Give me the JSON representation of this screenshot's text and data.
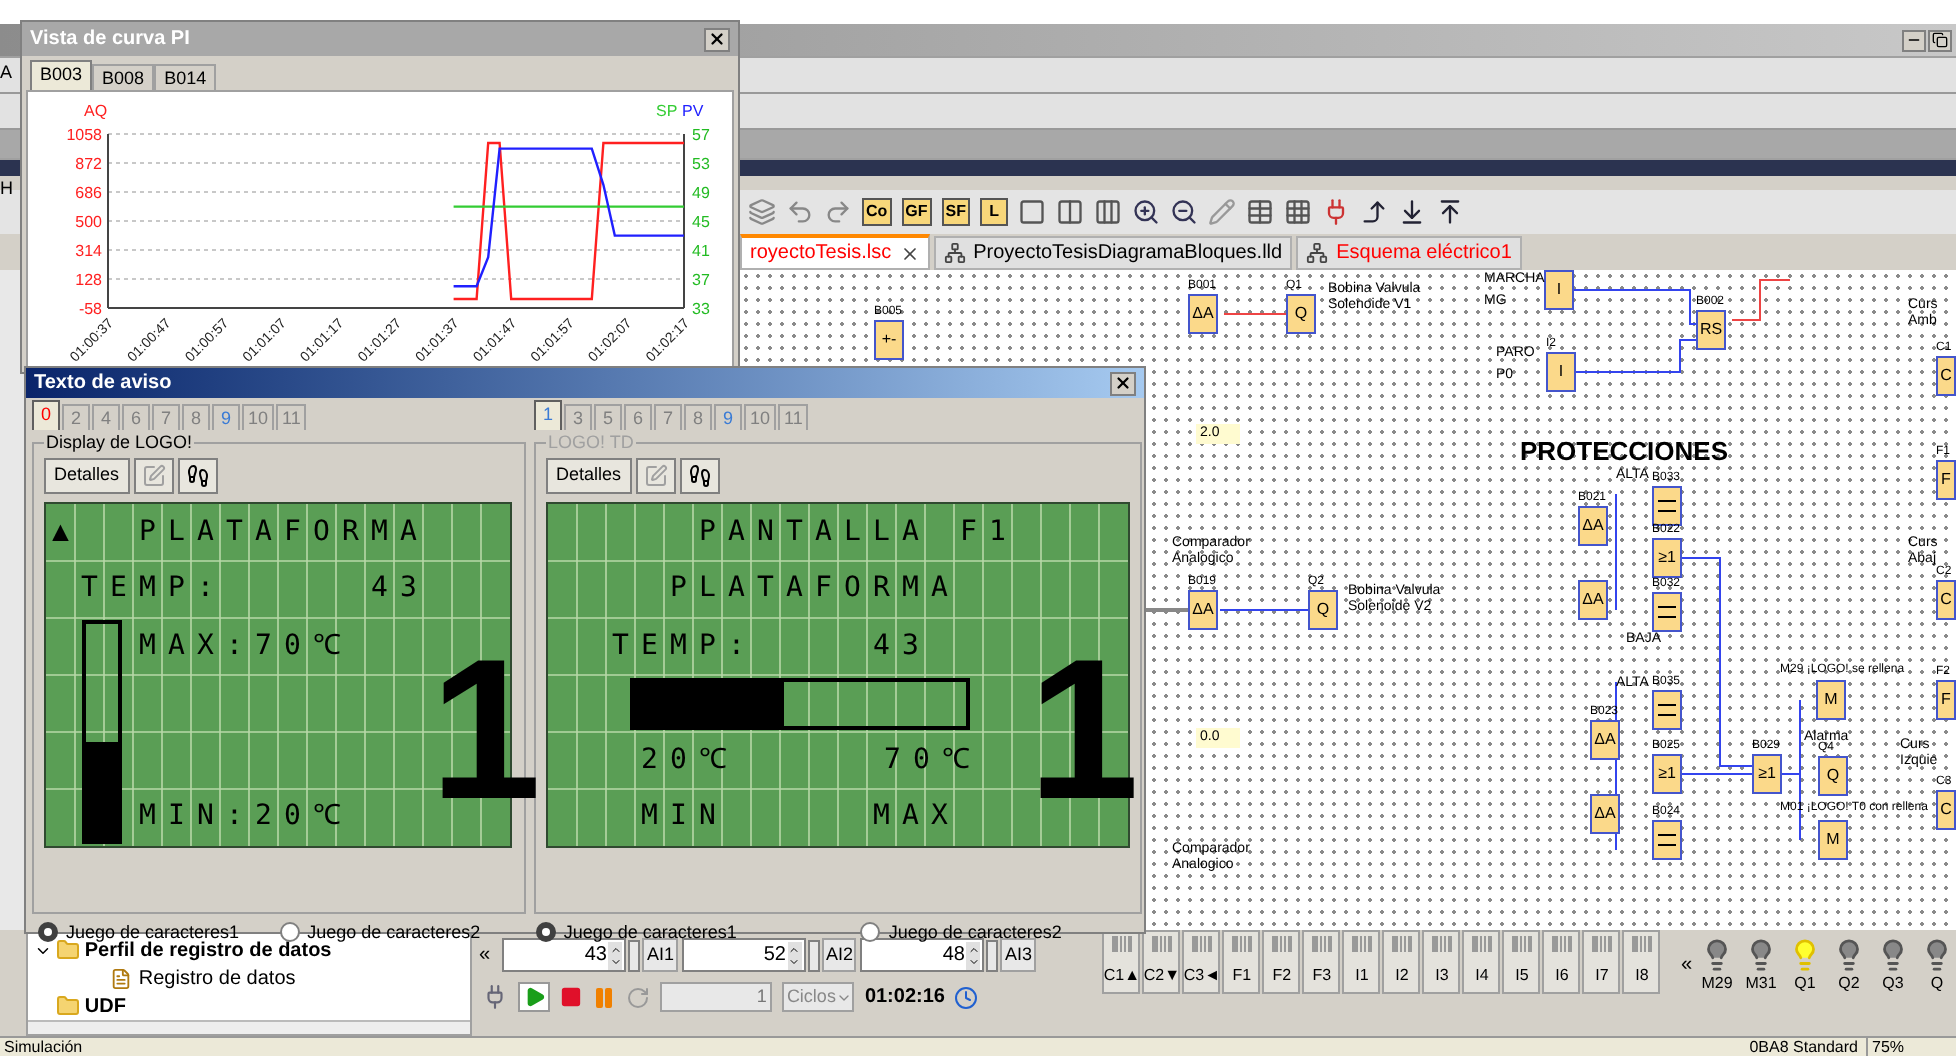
{
  "left_strip": {
    "labels": [
      "A",
      "H"
    ]
  },
  "chart_window": {
    "title": "Vista de curva PI",
    "tabs": [
      {
        "label": "B003",
        "selected": true
      },
      {
        "label": "B008",
        "selected": false
      },
      {
        "label": "B014",
        "selected": false
      }
    ],
    "chart_data": {
      "type": "line",
      "grid": true,
      "categories": [
        "01:00:37",
        null,
        null,
        null,
        null,
        "01:00:47",
        null,
        null,
        null,
        null,
        "01:00:57",
        null,
        null,
        null,
        null,
        "01:01:07",
        null,
        null,
        null,
        null,
        "01:01:17",
        null,
        null,
        null,
        null,
        "01:01:27",
        null,
        null,
        null,
        null,
        "01:01:37",
        null,
        null,
        null,
        null,
        "01:01:47",
        null,
        null,
        null,
        null,
        "01:01:57",
        null,
        null,
        null,
        null,
        "01:02:07",
        null,
        null,
        null,
        null,
        "01:02:17"
      ],
      "ylim": [
        -58,
        1058
      ],
      "yticks": [
        -58,
        128,
        314,
        500,
        686,
        872,
        1058
      ],
      "y2lim": [
        33,
        57
      ],
      "y2ticks": [
        33,
        37,
        41,
        45,
        49,
        53,
        57
      ],
      "series": [
        {
          "name": "AQ",
          "color": "#ff2020",
          "values": [
            null,
            null,
            null,
            null,
            null,
            null,
            null,
            null,
            null,
            null,
            null,
            null,
            null,
            null,
            null,
            null,
            null,
            null,
            null,
            null,
            null,
            null,
            null,
            null,
            null,
            null,
            null,
            null,
            null,
            null,
            0,
            0,
            0,
            1000,
            1000,
            0,
            0,
            0,
            0,
            0,
            0,
            0,
            0,
            1000,
            1000,
            1000,
            1000,
            1000,
            1000,
            1000,
            1000
          ]
        },
        {
          "name": "SP",
          "color": "#33cc33",
          "axis": "y2",
          "values": [
            null,
            null,
            null,
            null,
            null,
            null,
            null,
            null,
            null,
            null,
            null,
            null,
            null,
            null,
            null,
            null,
            null,
            null,
            null,
            null,
            null,
            null,
            null,
            null,
            null,
            null,
            null,
            null,
            null,
            null,
            47,
            47,
            47,
            47,
            47,
            47,
            47,
            47,
            47,
            47,
            47,
            47,
            47,
            47,
            47,
            47,
            47,
            47,
            47,
            47,
            47
          ]
        },
        {
          "name": "PV",
          "color": "#2020ff",
          "axis": "y2",
          "values": [
            null,
            null,
            null,
            null,
            null,
            null,
            null,
            null,
            null,
            null,
            null,
            null,
            null,
            null,
            null,
            null,
            null,
            null,
            null,
            null,
            null,
            null,
            null,
            null,
            null,
            null,
            null,
            null,
            null,
            null,
            36,
            36,
            36,
            40,
            55,
            55,
            55,
            55,
            55,
            55,
            55,
            55,
            55,
            50,
            43,
            43,
            43,
            43,
            43,
            43,
            43
          ]
        }
      ]
    }
  },
  "app": {
    "toolbar": {
      "buttons": [
        "Co",
        "GF",
        "SF",
        "L"
      ]
    },
    "tabs": [
      {
        "label": "royectoTesis.lsc",
        "selected": true,
        "color": "#ff0000"
      },
      {
        "label": "ProyectoTesisDiagramaBloques.lld",
        "selected": false,
        "color": "#000000"
      },
      {
        "label": "Esquema eléctrico1",
        "selected": false,
        "color": "#ff0000"
      }
    ],
    "diagram": {
      "labels": [
        "MARCHA",
        "MG",
        "PARO",
        "P0",
        "Bobina Valvula Solenoide V1",
        "Comparador Analogico",
        "Bobina Valvula Solenoide V2",
        "PROTECCIONES",
        "ALTA",
        "BAJA",
        "ALTA",
        "M29 ¡LOGO! se rellena",
        "Alarma",
        "M01 ¡LOGO! T0 con rellena",
        "Comparador Analogico",
        "Curs Amb",
        "Curs Abaj",
        "Curs Izquie",
        "2.0",
        "0.0"
      ],
      "blocks": [
        {
          "id": "B005",
          "kind": "logic",
          "symbol": "+-"
        },
        {
          "id": "B001",
          "kind": "logic",
          "symbol": "ΔA"
        },
        {
          "id": "Q1",
          "kind": "logic",
          "symbol": "Q"
        },
        {
          "kind": "logic",
          "symbol": "I"
        },
        {
          "id": "B002",
          "kind": "logic",
          "symbol": "RS"
        },
        {
          "id": "I2",
          "kind": "logic",
          "symbol": "I"
        },
        {
          "id": "B019",
          "kind": "logic",
          "symbol": "ΔA"
        },
        {
          "id": "Q2",
          "kind": "logic",
          "symbol": "Q"
        },
        {
          "id": "B021",
          "kind": "logic",
          "symbol": "ΔA"
        },
        {
          "id": "B033",
          "kind": "message"
        },
        {
          "id": "B022",
          "kind": "logic",
          "symbol": "≥1"
        },
        {
          "kind": "logic",
          "symbol": "ΔA"
        },
        {
          "id": "B032",
          "kind": "message"
        },
        {
          "id": "B035",
          "kind": "message"
        },
        {
          "id": "B023",
          "kind": "logic",
          "symbol": "ΔA"
        },
        {
          "id": "B025",
          "kind": "logic",
          "symbol": "≥1"
        },
        {
          "kind": "logic",
          "symbol": "ΔA"
        },
        {
          "id": "B024",
          "kind": "message"
        },
        {
          "id": "B029",
          "kind": "logic",
          "symbol": "≥1"
        },
        {
          "kind": "logic",
          "symbol": "M"
        },
        {
          "id": "Q4",
          "kind": "logic",
          "symbol": "Q"
        },
        {
          "kind": "logic",
          "symbol": "M"
        },
        {
          "id": "C1",
          "kind": "logic",
          "symbol": "C"
        },
        {
          "id": "F1",
          "kind": "logic",
          "symbol": "F"
        },
        {
          "id": "C2",
          "kind": "logic",
          "symbol": "C"
        },
        {
          "id": "F2",
          "kind": "logic",
          "symbol": "F"
        },
        {
          "id": "C3",
          "kind": "logic",
          "symbol": "C"
        }
      ]
    }
  },
  "message_window": {
    "title": "Texto de aviso",
    "panels": [
      {
        "tabs": [
          {
            "label": "0",
            "selected": true,
            "color": "#ff0000"
          },
          {
            "label": "2",
            "selected": false,
            "color": "#808080"
          },
          {
            "label": "4",
            "selected": false,
            "color": "#808080"
          },
          {
            "label": "6",
            "selected": false,
            "color": "#808080"
          },
          {
            "label": "7",
            "selected": false,
            "color": "#808080"
          },
          {
            "label": "8",
            "selected": false,
            "color": "#808080"
          },
          {
            "label": "9",
            "selected": false,
            "color": "#3a7bd5"
          },
          {
            "label": "10",
            "selected": false,
            "color": "#808080"
          },
          {
            "label": "11",
            "selected": false,
            "color": "#808080"
          }
        ],
        "title": "Display de LOGO!",
        "disabled": false,
        "button": "Detalles",
        "display": {
          "lines": [
            "▲  PLATAFORMA",
            "TEMP:     43",
            "MAX:70℃",
            "MIN:20℃"
          ],
          "big_digit": "1",
          "bar": {
            "kind": "vertical",
            "level": 0.45
          }
        },
        "charsets": [
          {
            "label": "Juego de caracteres1",
            "selected": true
          },
          {
            "label": "Juego de caracteres2",
            "selected": false
          }
        ]
      },
      {
        "tabs": [
          {
            "label": "1",
            "selected": true,
            "color": "#3a7bd5"
          },
          {
            "label": "3",
            "selected": false,
            "color": "#808080"
          },
          {
            "label": "5",
            "selected": false,
            "color": "#808080"
          },
          {
            "label": "6",
            "selected": false,
            "color": "#808080"
          },
          {
            "label": "7",
            "selected": false,
            "color": "#808080"
          },
          {
            "label": "8",
            "selected": false,
            "color": "#808080"
          },
          {
            "label": "9",
            "selected": false,
            "color": "#3a7bd5"
          },
          {
            "label": "10",
            "selected": false,
            "color": "#808080"
          },
          {
            "label": "11",
            "selected": false,
            "color": "#808080"
          }
        ],
        "title": "LOGO! TD",
        "disabled": true,
        "button": "Detalles",
        "display": {
          "lines": [
            "PANTALLA F1",
            "PLATAFORMA",
            "TEMP:    43",
            "20℃     70℃",
            "MIN     MAX"
          ],
          "big_digit": "1",
          "bar": {
            "kind": "horizontal",
            "level": 0.45
          }
        },
        "charsets": [
          {
            "label": "Juego de caracteres1",
            "selected": true
          },
          {
            "label": "Juego de caracteres2",
            "selected": false
          }
        ]
      }
    ]
  },
  "tree": [
    {
      "label": "Perfil de registro de datos",
      "expanded": true,
      "children": [
        {
          "label": "Registro de datos"
        }
      ]
    },
    {
      "label": "UDF"
    }
  ],
  "simulation": {
    "collapse": "«",
    "analog_inputs": [
      {
        "value": "43",
        "label": "AI1"
      },
      {
        "value": "52",
        "label": "AI2"
      },
      {
        "value": "48",
        "label": "AI3"
      }
    ],
    "cycles": "1",
    "cycles_unit": "Ciclos",
    "time": "01:02:16",
    "inputs": [
      "C1▲",
      "C2▼",
      "C3◄",
      "F1",
      "F2",
      "F3",
      "I1",
      "I2",
      "I3",
      "I4",
      "I5",
      "I6",
      "I7",
      "I8"
    ],
    "outputs_collapse": "«",
    "lamps": [
      {
        "label": "M29",
        "on": false
      },
      {
        "label": "M31",
        "on": false
      },
      {
        "label": "Q1",
        "on": true
      },
      {
        "label": "Q2",
        "on": false
      },
      {
        "label": "Q3",
        "on": false
      },
      {
        "label": "Q",
        "on": false
      }
    ]
  },
  "status_bar": {
    "mode": "Simulación",
    "device": "0BA8 Standard",
    "zoom": "75%"
  }
}
